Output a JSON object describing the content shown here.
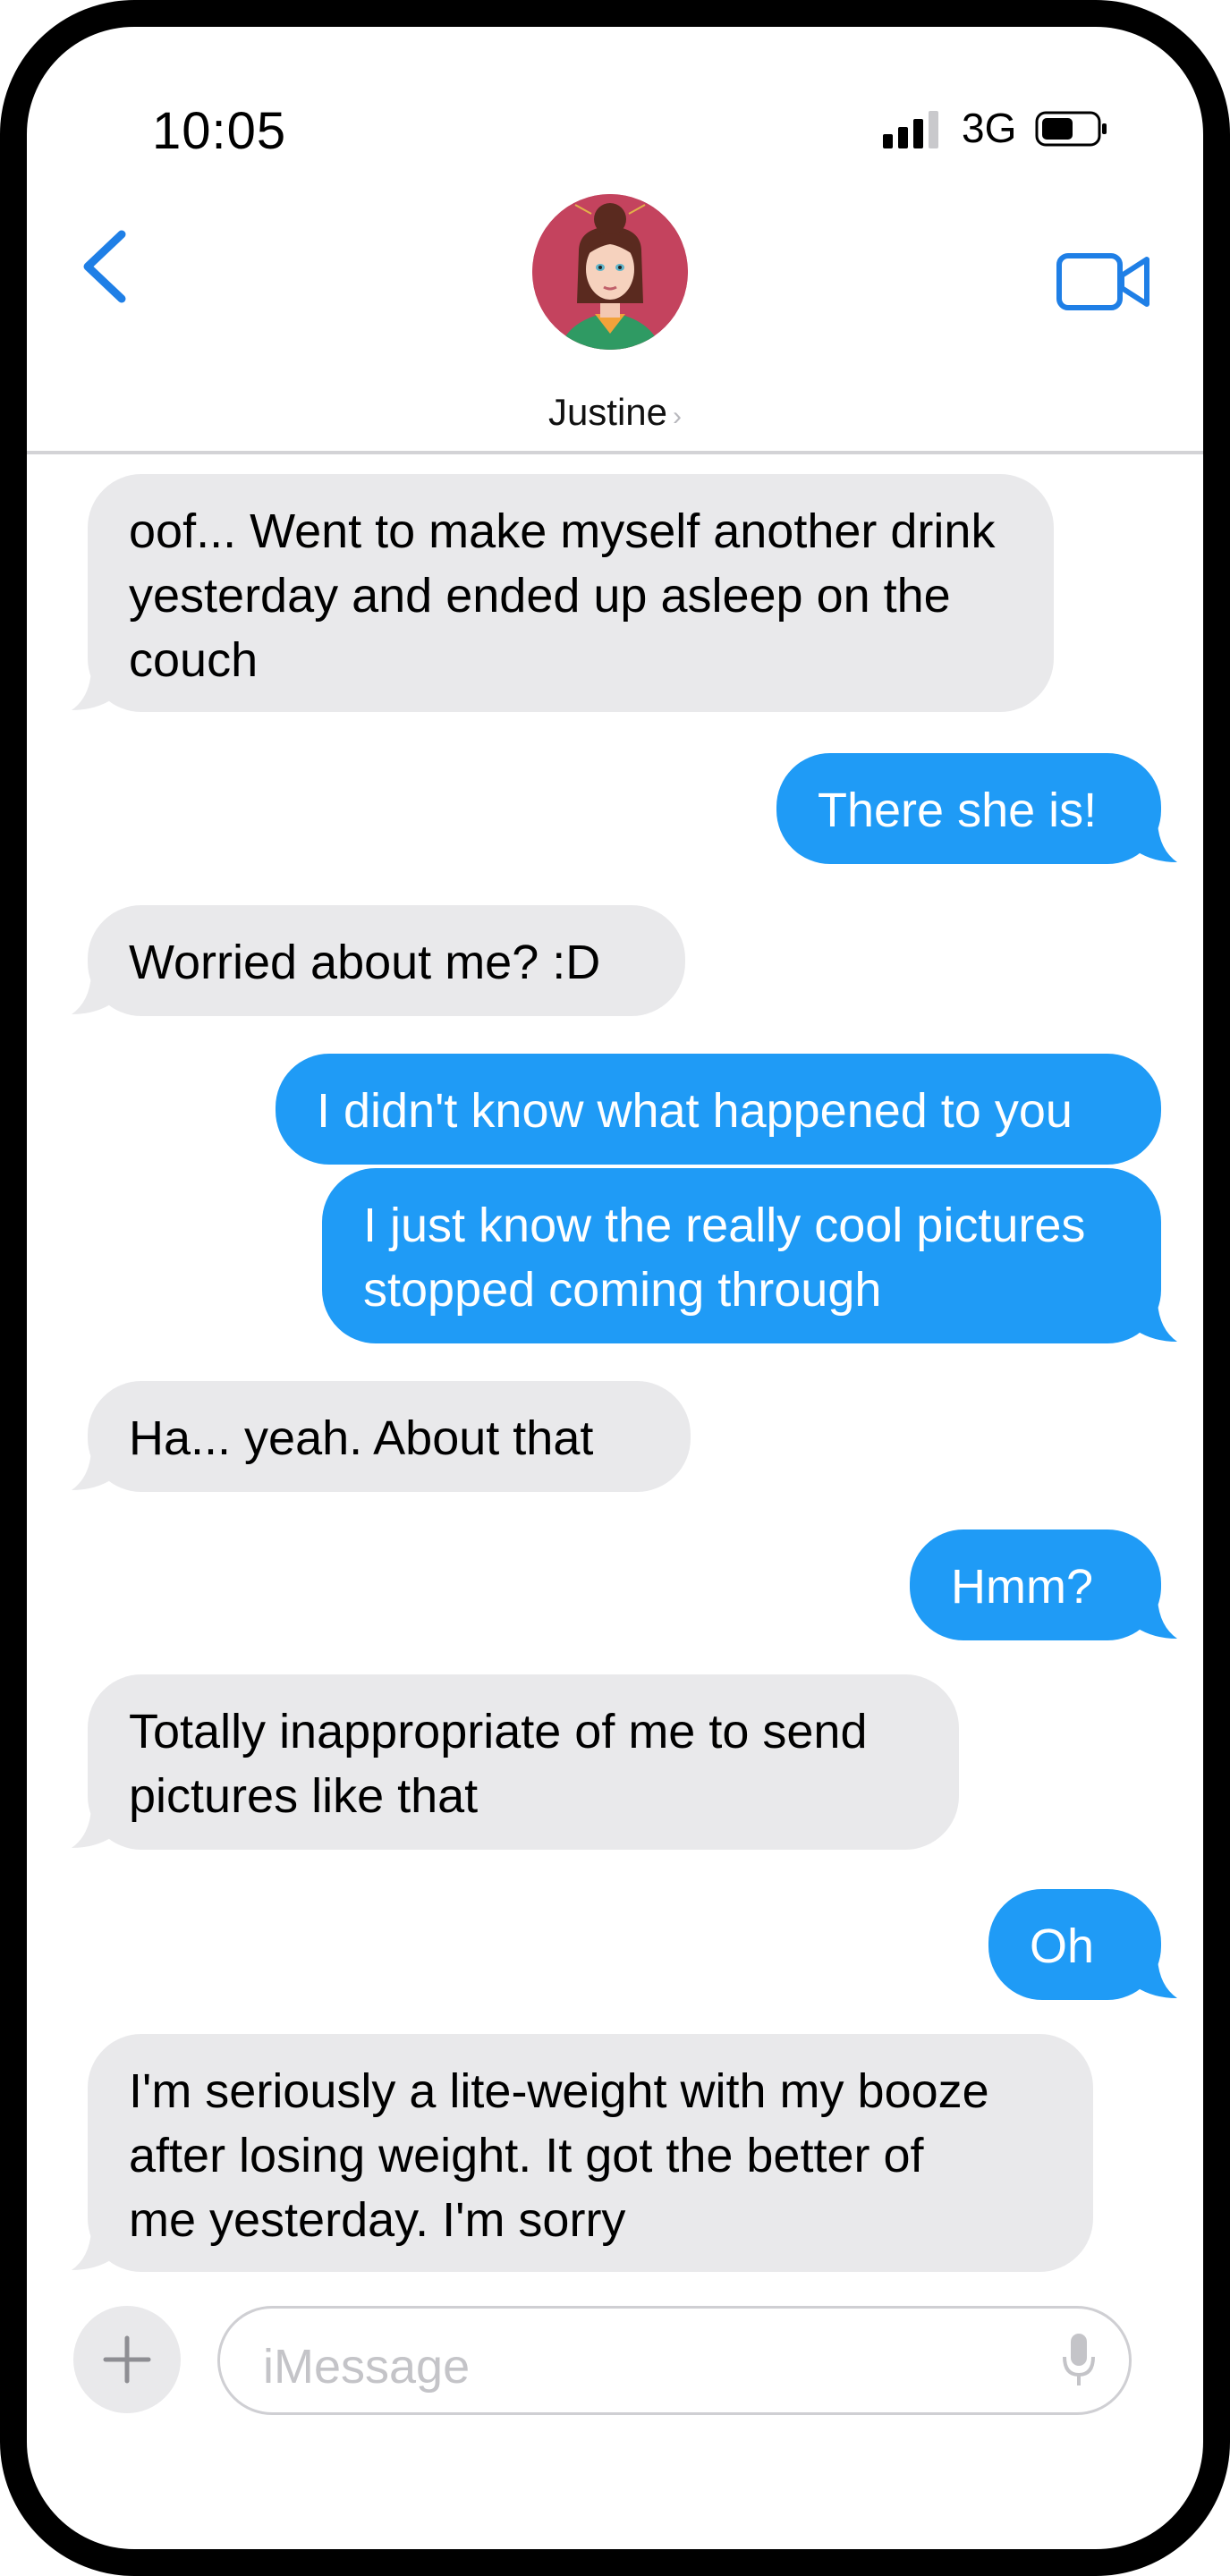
{
  "status_bar": {
    "time": "10:05",
    "network": "3G",
    "icons": [
      "signal-icon",
      "battery-icon"
    ]
  },
  "header": {
    "contact_name": "Justine",
    "name_chevron": "›",
    "icons": [
      "back-chevron-icon",
      "avatar",
      "video-camera-icon"
    ],
    "accent_color": "#1f7fe6"
  },
  "messages": [
    {
      "direction": "incoming",
      "lines": [
        "oof... Went to make myself another drink",
        "yesterday and ended up asleep on the",
        "couch"
      ]
    },
    {
      "direction": "outgoing",
      "lines": [
        "There she is!"
      ]
    },
    {
      "direction": "incoming",
      "lines": [
        "Worried about me? :D"
      ]
    },
    {
      "direction": "outgoing",
      "lines": [
        "I didn't know what happened to you"
      ]
    },
    {
      "direction": "outgoing",
      "lines": [
        "I just know the really cool pictures",
        "stopped coming through"
      ]
    },
    {
      "direction": "incoming",
      "lines": [
        "Ha... yeah.  About that"
      ]
    },
    {
      "direction": "outgoing",
      "lines": [
        "Hmm?"
      ]
    },
    {
      "direction": "incoming",
      "lines": [
        "Totally inappropriate of me to send",
        "pictures like that"
      ]
    },
    {
      "direction": "outgoing",
      "lines": [
        "Oh"
      ]
    },
    {
      "direction": "incoming",
      "lines": [
        "I'm seriously a lite-weight with my booze",
        "after losing weight.  It got the better of",
        "me yesterday.  I'm sorry"
      ]
    }
  ],
  "colors": {
    "incoming_bubble": "#e9e9eb",
    "outgoing_bubble": "#1f9bf6"
  },
  "composer": {
    "placeholder": "iMessage",
    "icons": [
      "plus-icon",
      "microphone-icon"
    ]
  }
}
